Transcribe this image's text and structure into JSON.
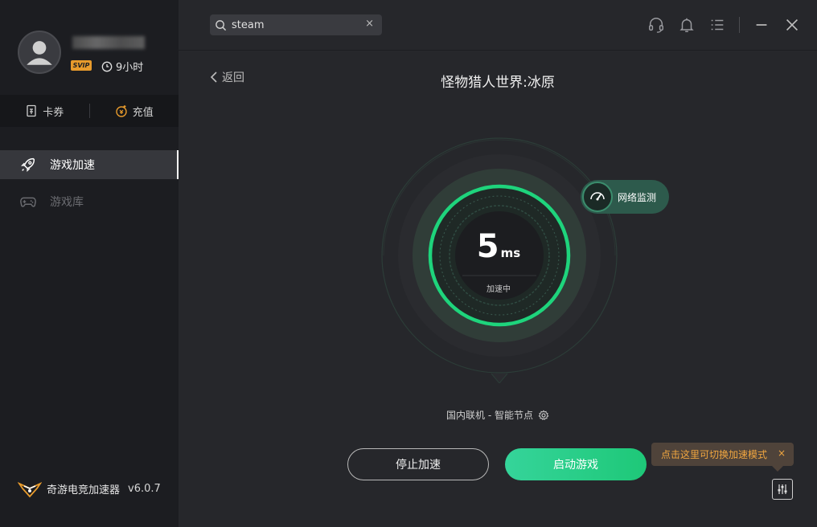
{
  "user": {
    "badge": "SVIP",
    "hours": "9小时"
  },
  "wallet": {
    "coupon_label": "卡券",
    "recharge_label": "充值"
  },
  "nav": {
    "items": [
      {
        "label": "游戏加速",
        "icon": "rocket-icon",
        "active": true
      },
      {
        "label": "游戏库",
        "icon": "gamepad-icon",
        "active": false
      }
    ]
  },
  "brand": {
    "name": "奇游电竞加速器",
    "version": "v6.0.7"
  },
  "search": {
    "value": "steam",
    "clear": "×"
  },
  "header": {
    "back_label": "返回",
    "game_title": "怪物猎人世界:冰原"
  },
  "gauge": {
    "latency_value": "5",
    "latency_unit": "ms",
    "status": "加速中"
  },
  "monitor": {
    "label": "网络监测"
  },
  "node": {
    "label": "国内联机 - 智能节点"
  },
  "actions": {
    "stop_label": "停止加速",
    "start_label": "启动游戏"
  },
  "tooltip": {
    "text": "点击这里可切换加速模式",
    "close": "×"
  },
  "colors": {
    "accent_green": "#1ec878",
    "svip_orange": "#e89b2c",
    "tooltip_text": "#f0a640"
  }
}
